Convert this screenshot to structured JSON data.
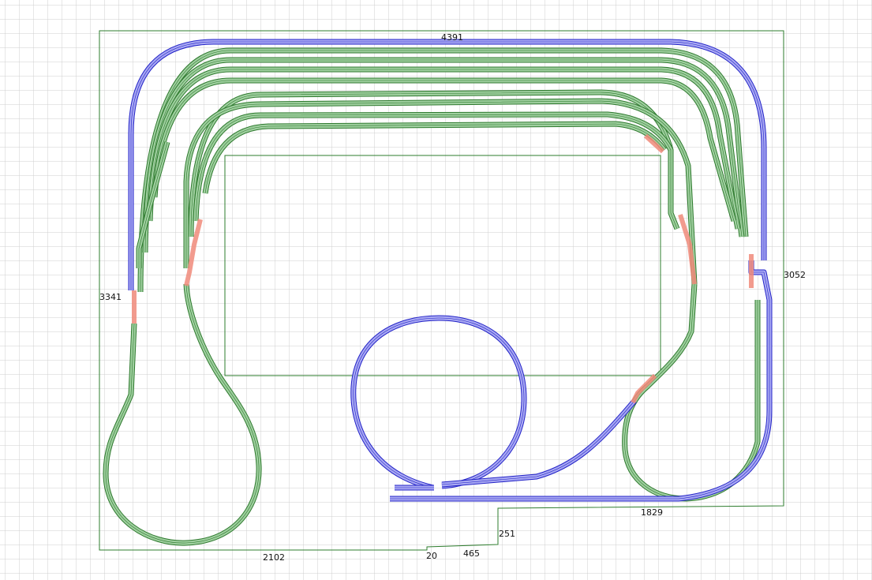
{
  "dimensions": {
    "top": "4391",
    "right": "3052",
    "left": "3341",
    "bottom_left": "2102",
    "notch_small": "20",
    "notch_bottom": "465",
    "notch_vertical": "251",
    "bottom_right": "1829"
  },
  "colors": {
    "grid": "#cfcfcf",
    "board_outline": "#2e7d2e",
    "track_green_fill": "#9fcf9f",
    "track_green_edge": "#2f7a2f",
    "track_blue_fill": "#a9a9f2",
    "track_blue_edge": "#2424c8",
    "turnout_red": "#f08a7a"
  },
  "legend_icons": [
    "track-green",
    "track-blue",
    "turnout-red"
  ]
}
